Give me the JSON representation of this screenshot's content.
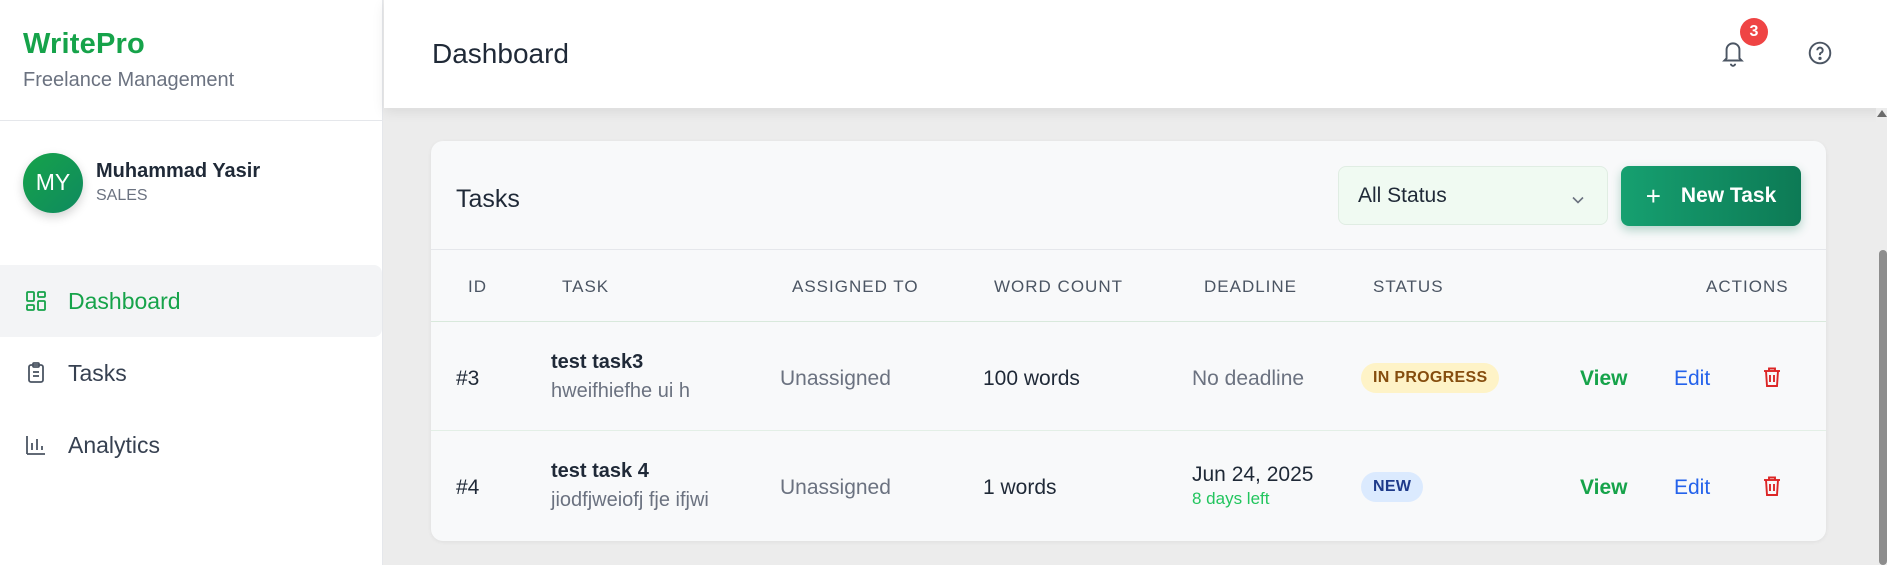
{
  "sidebar": {
    "brand": "WritePro",
    "subtitle": "Freelance Management",
    "user": {
      "initials": "MY",
      "name": "Muhammad Yasir",
      "role": "SALES"
    },
    "nav": [
      {
        "label": "Dashboard",
        "icon": "grid-icon",
        "active": true
      },
      {
        "label": "Tasks",
        "icon": "clipboard-icon",
        "active": false
      },
      {
        "label": "Analytics",
        "icon": "bar-chart-icon",
        "active": false
      }
    ]
  },
  "header": {
    "title": "Dashboard",
    "notification_count": "3"
  },
  "tasks": {
    "title": "Tasks",
    "filter": {
      "selected": "All Status"
    },
    "new_task_label": "New Task",
    "columns": [
      "ID",
      "TASK",
      "ASSIGNED TO",
      "WORD COUNT",
      "DEADLINE",
      "STATUS",
      "ACTIONS"
    ],
    "rows": [
      {
        "id": "#3",
        "title": "test task3",
        "description": "hweifhiefhe ui h",
        "assigned": "Unassigned",
        "word_count": "100 words",
        "deadline": "No deadline",
        "deadline_note": "",
        "status": "IN PROGRESS",
        "view": "View",
        "edit": "Edit"
      },
      {
        "id": "#4",
        "title": "test task 4",
        "description": "jiodfjweiofj fje ifjwi",
        "assigned": "Unassigned",
        "word_count": "1 words",
        "deadline": "Jun 24, 2025",
        "deadline_note": "8 days left",
        "status": "NEW",
        "view": "View",
        "edit": "Edit"
      }
    ]
  },
  "colors": {
    "brand_green": "#16a34a",
    "button_green": "#0f8a5f",
    "link_blue": "#2563eb",
    "danger_red": "#dc2626",
    "badge_red": "#ef4444"
  }
}
